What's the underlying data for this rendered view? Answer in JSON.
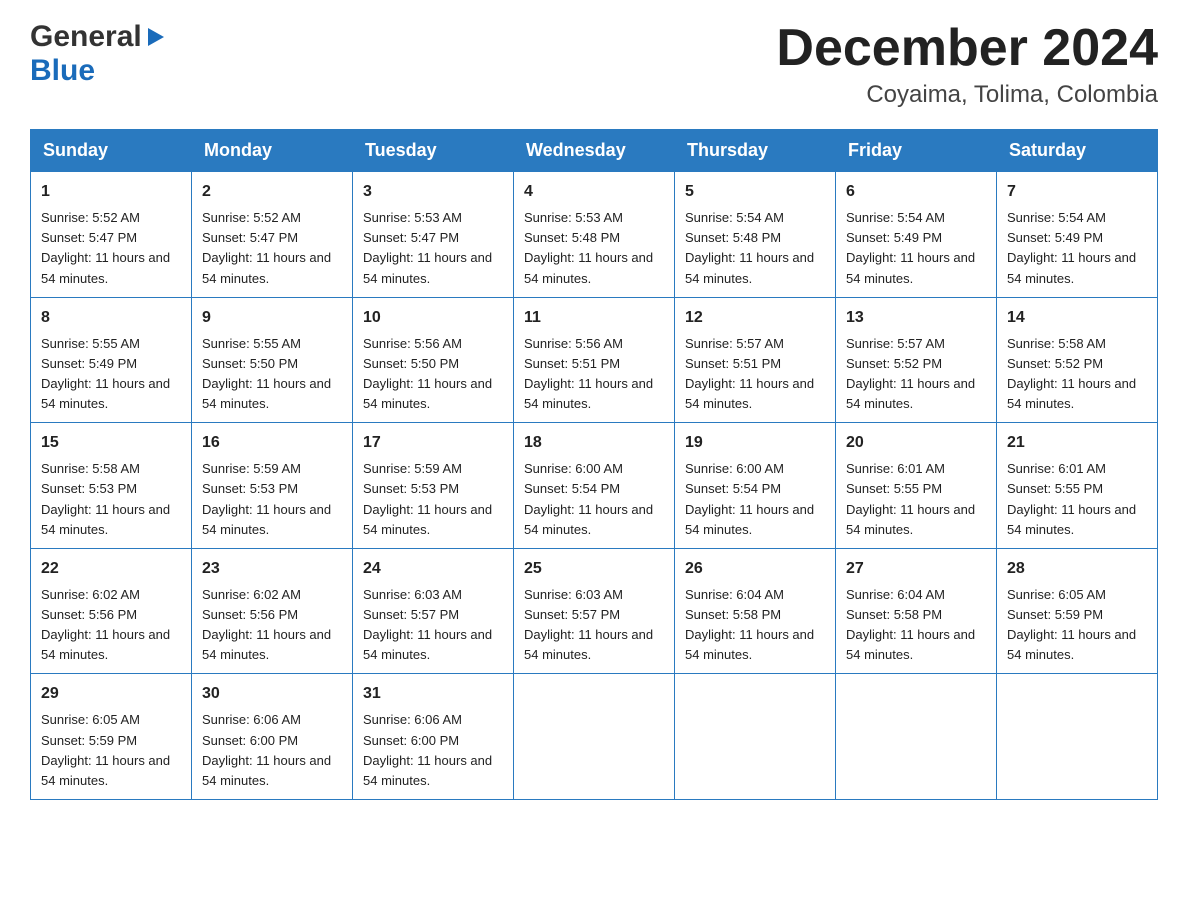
{
  "header": {
    "logo": {
      "general": "General",
      "blue": "Blue",
      "arrow": "▶"
    },
    "title": "December 2024",
    "location": "Coyaima, Tolima, Colombia"
  },
  "calendar": {
    "days_of_week": [
      "Sunday",
      "Monday",
      "Tuesday",
      "Wednesday",
      "Thursday",
      "Friday",
      "Saturday"
    ],
    "weeks": [
      [
        {
          "day": "1",
          "sunrise": "Sunrise: 5:52 AM",
          "sunset": "Sunset: 5:47 PM",
          "daylight": "Daylight: 11 hours and 54 minutes."
        },
        {
          "day": "2",
          "sunrise": "Sunrise: 5:52 AM",
          "sunset": "Sunset: 5:47 PM",
          "daylight": "Daylight: 11 hours and 54 minutes."
        },
        {
          "day": "3",
          "sunrise": "Sunrise: 5:53 AM",
          "sunset": "Sunset: 5:47 PM",
          "daylight": "Daylight: 11 hours and 54 minutes."
        },
        {
          "day": "4",
          "sunrise": "Sunrise: 5:53 AM",
          "sunset": "Sunset: 5:48 PM",
          "daylight": "Daylight: 11 hours and 54 minutes."
        },
        {
          "day": "5",
          "sunrise": "Sunrise: 5:54 AM",
          "sunset": "Sunset: 5:48 PM",
          "daylight": "Daylight: 11 hours and 54 minutes."
        },
        {
          "day": "6",
          "sunrise": "Sunrise: 5:54 AM",
          "sunset": "Sunset: 5:49 PM",
          "daylight": "Daylight: 11 hours and 54 minutes."
        },
        {
          "day": "7",
          "sunrise": "Sunrise: 5:54 AM",
          "sunset": "Sunset: 5:49 PM",
          "daylight": "Daylight: 11 hours and 54 minutes."
        }
      ],
      [
        {
          "day": "8",
          "sunrise": "Sunrise: 5:55 AM",
          "sunset": "Sunset: 5:49 PM",
          "daylight": "Daylight: 11 hours and 54 minutes."
        },
        {
          "day": "9",
          "sunrise": "Sunrise: 5:55 AM",
          "sunset": "Sunset: 5:50 PM",
          "daylight": "Daylight: 11 hours and 54 minutes."
        },
        {
          "day": "10",
          "sunrise": "Sunrise: 5:56 AM",
          "sunset": "Sunset: 5:50 PM",
          "daylight": "Daylight: 11 hours and 54 minutes."
        },
        {
          "day": "11",
          "sunrise": "Sunrise: 5:56 AM",
          "sunset": "Sunset: 5:51 PM",
          "daylight": "Daylight: 11 hours and 54 minutes."
        },
        {
          "day": "12",
          "sunrise": "Sunrise: 5:57 AM",
          "sunset": "Sunset: 5:51 PM",
          "daylight": "Daylight: 11 hours and 54 minutes."
        },
        {
          "day": "13",
          "sunrise": "Sunrise: 5:57 AM",
          "sunset": "Sunset: 5:52 PM",
          "daylight": "Daylight: 11 hours and 54 minutes."
        },
        {
          "day": "14",
          "sunrise": "Sunrise: 5:58 AM",
          "sunset": "Sunset: 5:52 PM",
          "daylight": "Daylight: 11 hours and 54 minutes."
        }
      ],
      [
        {
          "day": "15",
          "sunrise": "Sunrise: 5:58 AM",
          "sunset": "Sunset: 5:53 PM",
          "daylight": "Daylight: 11 hours and 54 minutes."
        },
        {
          "day": "16",
          "sunrise": "Sunrise: 5:59 AM",
          "sunset": "Sunset: 5:53 PM",
          "daylight": "Daylight: 11 hours and 54 minutes."
        },
        {
          "day": "17",
          "sunrise": "Sunrise: 5:59 AM",
          "sunset": "Sunset: 5:53 PM",
          "daylight": "Daylight: 11 hours and 54 minutes."
        },
        {
          "day": "18",
          "sunrise": "Sunrise: 6:00 AM",
          "sunset": "Sunset: 5:54 PM",
          "daylight": "Daylight: 11 hours and 54 minutes."
        },
        {
          "day": "19",
          "sunrise": "Sunrise: 6:00 AM",
          "sunset": "Sunset: 5:54 PM",
          "daylight": "Daylight: 11 hours and 54 minutes."
        },
        {
          "day": "20",
          "sunrise": "Sunrise: 6:01 AM",
          "sunset": "Sunset: 5:55 PM",
          "daylight": "Daylight: 11 hours and 54 minutes."
        },
        {
          "day": "21",
          "sunrise": "Sunrise: 6:01 AM",
          "sunset": "Sunset: 5:55 PM",
          "daylight": "Daylight: 11 hours and 54 minutes."
        }
      ],
      [
        {
          "day": "22",
          "sunrise": "Sunrise: 6:02 AM",
          "sunset": "Sunset: 5:56 PM",
          "daylight": "Daylight: 11 hours and 54 minutes."
        },
        {
          "day": "23",
          "sunrise": "Sunrise: 6:02 AM",
          "sunset": "Sunset: 5:56 PM",
          "daylight": "Daylight: 11 hours and 54 minutes."
        },
        {
          "day": "24",
          "sunrise": "Sunrise: 6:03 AM",
          "sunset": "Sunset: 5:57 PM",
          "daylight": "Daylight: 11 hours and 54 minutes."
        },
        {
          "day": "25",
          "sunrise": "Sunrise: 6:03 AM",
          "sunset": "Sunset: 5:57 PM",
          "daylight": "Daylight: 11 hours and 54 minutes."
        },
        {
          "day": "26",
          "sunrise": "Sunrise: 6:04 AM",
          "sunset": "Sunset: 5:58 PM",
          "daylight": "Daylight: 11 hours and 54 minutes."
        },
        {
          "day": "27",
          "sunrise": "Sunrise: 6:04 AM",
          "sunset": "Sunset: 5:58 PM",
          "daylight": "Daylight: 11 hours and 54 minutes."
        },
        {
          "day": "28",
          "sunrise": "Sunrise: 6:05 AM",
          "sunset": "Sunset: 5:59 PM",
          "daylight": "Daylight: 11 hours and 54 minutes."
        }
      ],
      [
        {
          "day": "29",
          "sunrise": "Sunrise: 6:05 AM",
          "sunset": "Sunset: 5:59 PM",
          "daylight": "Daylight: 11 hours and 54 minutes."
        },
        {
          "day": "30",
          "sunrise": "Sunrise: 6:06 AM",
          "sunset": "Sunset: 6:00 PM",
          "daylight": "Daylight: 11 hours and 54 minutes."
        },
        {
          "day": "31",
          "sunrise": "Sunrise: 6:06 AM",
          "sunset": "Sunset: 6:00 PM",
          "daylight": "Daylight: 11 hours and 54 minutes."
        },
        null,
        null,
        null,
        null
      ]
    ]
  }
}
